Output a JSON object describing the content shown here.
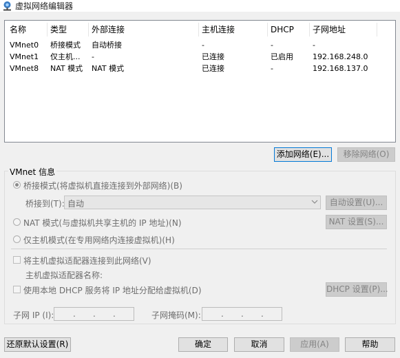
{
  "window": {
    "title": "虚拟网络编辑器",
    "icon": "network-icon"
  },
  "table": {
    "columns": [
      "名称",
      "类型",
      "外部连接",
      "主机连接",
      "DHCP",
      "子网地址"
    ],
    "rows": [
      {
        "name": "VMnet0",
        "type": "桥接模式",
        "external": "自动桥接",
        "host": "-",
        "dhcp": "-",
        "subnet": "-"
      },
      {
        "name": "VMnet1",
        "type": "仅主机...",
        "external": "-",
        "host": "已连接",
        "dhcp": "已启用",
        "subnet": "192.168.248.0"
      },
      {
        "name": "VMnet8",
        "type": "NAT 模式",
        "external": "NAT 模式",
        "host": "已连接",
        "dhcp": "-",
        "subnet": "192.168.137.0"
      }
    ]
  },
  "actions": {
    "add_network": "添加网络(E)...",
    "remove_network": "移除网络(O)"
  },
  "vmnet_info": {
    "title": "VMnet 信息",
    "bridged_label": "桥接模式(将虚拟机直接连接到外部网络)(B)",
    "bridge_to_label": "桥接到(T):",
    "bridge_to_value": "自动",
    "auto_settings": "自动设置(U)...",
    "nat_label": "NAT 模式(与虚拟机共享主机的 IP 地址)(N)",
    "nat_settings": "NAT 设置(S)...",
    "hostonly_label": "仅主机模式(在专用网络内连接虚拟机)(H)",
    "connect_adapter_label": "将主机虚拟适配器连接到此网络(V)",
    "adapter_name_label": "主机虚拟适配器名称:",
    "dhcp_label": "使用本地 DHCP 服务将 IP 地址分配给虚拟机(D)",
    "dhcp_settings": "DHCP 设置(P)...",
    "subnet_ip_label": "子网 IP (I):",
    "subnet_mask_label": "子网掩码(M):",
    "ip_dot": "."
  },
  "footer": {
    "restore_defaults": "还原默认设置(R)",
    "ok": "确定",
    "cancel": "取消",
    "apply": "应用(A)",
    "help": "帮助"
  }
}
